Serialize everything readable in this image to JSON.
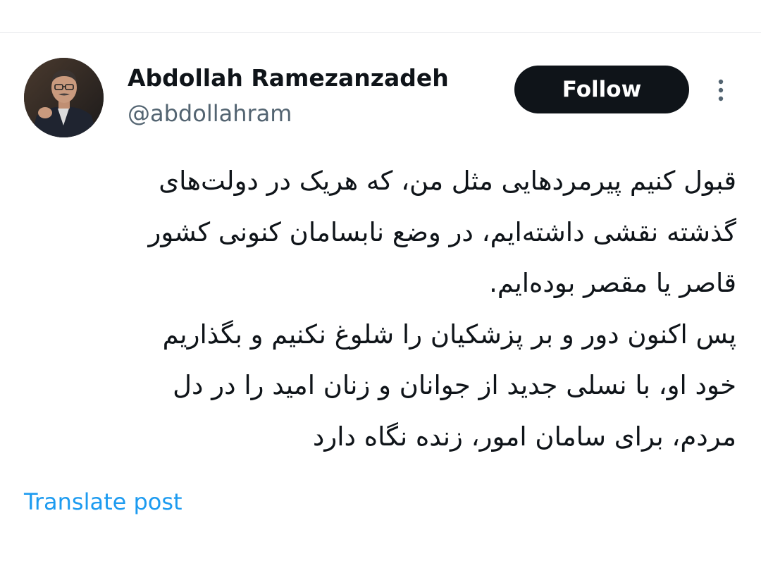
{
  "author": {
    "display_name": "Abdollah Ramezanzadeh",
    "handle": "@abdollahram",
    "avatar_icon": "profile-photo"
  },
  "actions": {
    "follow_label": "Follow",
    "more_icon": "more-vertical-icon"
  },
  "tweet": {
    "lines": [
      "قبول کنیم پیرمردهایی مثل من، که هریک در دولت‌های",
      "گذشته نقشی داشته‌ایم، در وضع نابسامان کنونی کشور",
      "قاصر یا مقصر بوده‌ایم.",
      "پس اکنون دور و بر پزشکیان را شلوغ نکنیم و بگذاریم",
      "خود او، با نسلی جدید از جوانان و زنان امید را در دل",
      "مردم، برای سامان امور، زنده نگاه دارد"
    ]
  },
  "translate": {
    "label": "Translate post"
  },
  "colors": {
    "text_primary": "#0f1419",
    "text_secondary": "#536471",
    "link": "#1d9bf0",
    "follow_bg": "#0f1419",
    "follow_text": "#ffffff"
  }
}
